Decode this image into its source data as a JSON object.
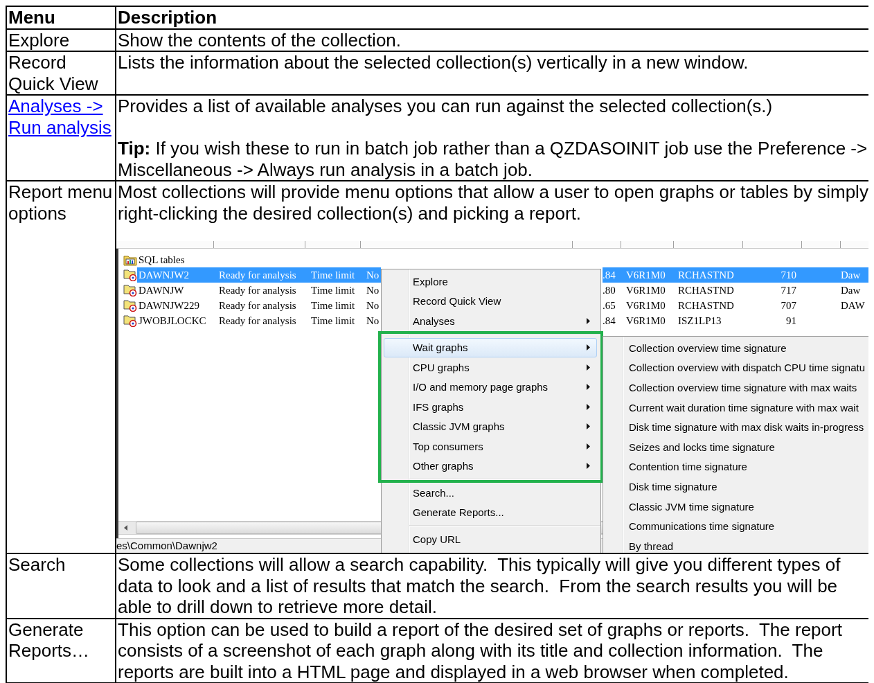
{
  "table": {
    "columns": [
      "Menu",
      "Description"
    ],
    "rows": [
      {
        "menu": {
          "text": "Explore",
          "link": false
        },
        "description": [
          {
            "kind": "text",
            "text": "Show the contents of the collection.",
            "spaced": false
          }
        ]
      },
      {
        "menu": {
          "text": "Record Quick View",
          "link": false
        },
        "description": [
          {
            "kind": "text",
            "text": "Lists the information about the selected collection(s) vertically in a new window.",
            "spaced": false
          }
        ]
      },
      {
        "menu": {
          "text": "Analyses -> Run analysis",
          "link": true
        },
        "description": [
          {
            "kind": "text",
            "text": "Provides a list of available analyses you can run against the selected collection(s.)",
            "spaced": false
          },
          {
            "kind": "text",
            "text": "**Tip:** If you wish these to run in batch job rather than a QZDASOINIT job use the Preference -> Miscellaneous -> Always run analysis in a batch job.",
            "spaced": true
          }
        ]
      },
      {
        "menu": {
          "text": "Report menu options",
          "link": false
        },
        "description": [
          {
            "kind": "text",
            "text": "Most collections will provide menu options that allow a user to open graphs or tables by simply right-clicking the desired collection(s) and picking a report.",
            "spaced": false
          },
          {
            "kind": "screenshot",
            "list": [
              {
                "kind": "folder",
                "name": "SQL tables",
                "selected": false
              },
              {
                "kind": "collection",
                "name": "DAWNJW2",
                "selected": true,
                "cells": [
                  "Ready for analysis",
                  "Time limit",
                  "No",
                  ".84",
                  "V6R1M0",
                  "RCHASTND",
                  "710",
                  "Daw"
                ]
              },
              {
                "kind": "collection",
                "name": "DAWNJW",
                "selected": false,
                "cells": [
                  "Ready for analysis",
                  "Time limit",
                  "No",
                  ".80",
                  "V6R1M0",
                  "RCHASTND",
                  "717",
                  "Daw"
                ]
              },
              {
                "kind": "collection",
                "name": "DAWNJW229",
                "selected": false,
                "cells": [
                  "Ready for analysis",
                  "Time limit",
                  "No",
                  ".65",
                  "V6R1M0",
                  "RCHASTND",
                  "707",
                  "DAW"
                ]
              },
              {
                "kind": "collection",
                "name": "JWOBJLOCKC",
                "selected": false,
                "cells": [
                  "Ready for analysis",
                  "Time limit",
                  "No",
                  ".84",
                  "V6R1M0",
                  "ISZ1LP13",
                  "91"
                ]
              }
            ],
            "status_text": "es\\Common\\Dawnjw2",
            "context_menu": {
              "groups": [
                {
                  "highlighted": false,
                  "items": [
                    {
                      "label": "Explore",
                      "submenu": false,
                      "selected": false
                    },
                    {
                      "label": "Record Quick View",
                      "submenu": false,
                      "selected": false
                    },
                    {
                      "label": "Analyses",
                      "submenu": true,
                      "selected": false
                    }
                  ]
                },
                {
                  "highlighted": true,
                  "items": [
                    {
                      "label": "Wait graphs",
                      "submenu": true,
                      "selected": true
                    },
                    {
                      "label": "CPU graphs",
                      "submenu": true,
                      "selected": false
                    },
                    {
                      "label": "I/O and memory page graphs",
                      "submenu": true,
                      "selected": false
                    },
                    {
                      "label": "IFS graphs",
                      "submenu": true,
                      "selected": false
                    },
                    {
                      "label": "Classic JVM graphs",
                      "submenu": true,
                      "selected": false
                    },
                    {
                      "label": "Top consumers",
                      "submenu": true,
                      "selected": false
                    },
                    {
                      "label": "Other graphs",
                      "submenu": true,
                      "selected": false
                    }
                  ]
                },
                {
                  "highlighted": false,
                  "items": [
                    {
                      "label": "Search...",
                      "submenu": false,
                      "selected": false
                    },
                    {
                      "label": "Generate Reports...",
                      "submenu": false,
                      "selected": false
                    }
                  ]
                },
                {
                  "highlighted": false,
                  "items": [
                    {
                      "label": "Copy URL",
                      "submenu": false,
                      "selected": false
                    }
                  ]
                }
              ]
            },
            "submenu": [
              "Collection overview time signature",
              "Collection overview with dispatch CPU time signatu",
              "Collection overview time signature with max waits",
              "Current wait duration time signature with max wait",
              "Disk time signature with max disk waits in-progress",
              "Seizes and locks time signature",
              "Contention time signature",
              "Disk time signature",
              "Classic JVM time signature",
              "Communications time signature",
              "By thread"
            ]
          }
        ]
      },
      {
        "menu": {
          "text": "Search",
          "link": false
        },
        "description": [
          {
            "kind": "text",
            "text": "Some collections will allow a search capability.  This typically will give you different types of data to look and a list of results that match the search.  From the search results you will be able to drill down to retrieve more detail.",
            "spaced": false
          }
        ]
      },
      {
        "menu": {
          "text": "Generate Reports…",
          "link": false
        },
        "description": [
          {
            "kind": "text",
            "text": "This option can be used to build a report of the desired set of graphs or reports.  The report consists of a screenshot of each graph along with its title and collection information.  The reports are built into a HTML page and displayed in a web browser when completed.",
            "spaced": false
          }
        ]
      }
    ]
  }
}
